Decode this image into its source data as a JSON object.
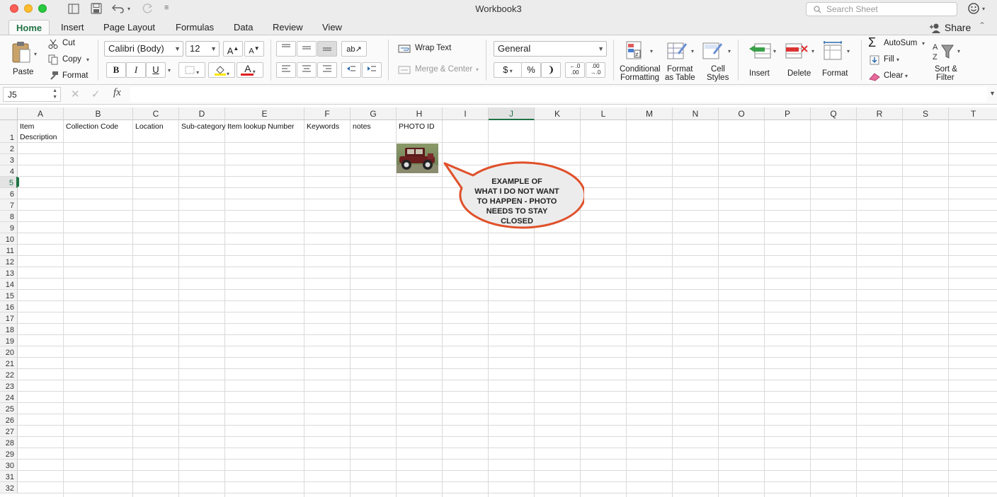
{
  "window": {
    "title": "Workbook3",
    "search_placeholder": "Search Sheet"
  },
  "tabs": [
    "Home",
    "Insert",
    "Page Layout",
    "Formulas",
    "Data",
    "Review",
    "View"
  ],
  "share_label": "Share",
  "clipboard": {
    "paste": "Paste",
    "cut": "Cut",
    "copy": "Copy",
    "format": "Format"
  },
  "font": {
    "name": "Calibri (Body)",
    "size": "12",
    "bold": "B",
    "italic": "I",
    "underline": "U"
  },
  "alignment": {
    "wrap_text": "Wrap Text",
    "merge_center": "Merge & Center"
  },
  "number": {
    "format": "General",
    "currency": "$",
    "percent": "%",
    "comma": "❩"
  },
  "styles": {
    "conditional": "Conditional",
    "conditional2": "Formatting",
    "format_as": "Format",
    "format_as2": "as Table",
    "cell": "Cell",
    "cell2": "Styles"
  },
  "cells_group": {
    "insert": "Insert",
    "delete": "Delete",
    "format": "Format"
  },
  "editing": {
    "autosum": "AutoSum",
    "fill": "Fill",
    "clear": "Clear",
    "sort": "Sort &",
    "sort2": "Filter"
  },
  "formula_bar": {
    "name_box": "J5",
    "fx": "fx",
    "value": ""
  },
  "columns": [
    "A",
    "B",
    "C",
    "D",
    "E",
    "F",
    "G",
    "H",
    "I",
    "J",
    "K",
    "L",
    "M",
    "N",
    "O",
    "P",
    "Q",
    "R",
    "S",
    "T"
  ],
  "selected_column": "J",
  "selected_row": 5,
  "row_count": 32,
  "header_row": {
    "A": [
      "Item",
      "Description"
    ],
    "B": "Collection Code",
    "C": "Location",
    "D": "Sub-category",
    "E": "Item lookup Number",
    "F": "Keywords",
    "G": "notes",
    "H": "PHOTO ID"
  },
  "callout": {
    "lines": [
      "EXAMPLE OF",
      "WHAT I DO NOT WANT",
      "TO HAPPEN - PHOTO",
      "NEEDS TO STAY",
      "CLOSED"
    ],
    "border_color": "#e0502a"
  },
  "photo": {
    "description": "vintage-car-photo"
  },
  "colors": {
    "accent": "#217346",
    "title_bg": "#ececec"
  }
}
